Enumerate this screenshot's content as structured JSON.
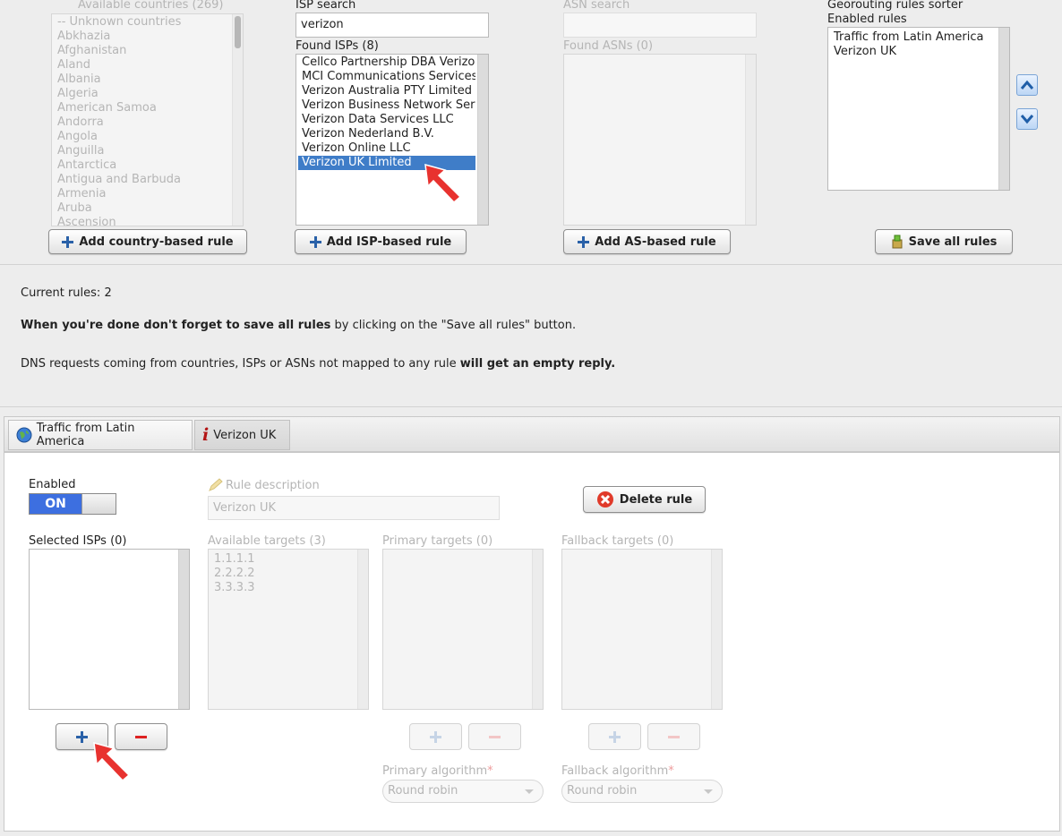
{
  "countries": {
    "label": "Available countries (269)",
    "items": [
      "-- Unknown countries",
      "Abkhazia",
      "Afghanistan",
      "Aland",
      "Albania",
      "Algeria",
      "American Samoa",
      "Andorra",
      "Angola",
      "Anguilla",
      "Antarctica",
      "Antigua and Barbuda",
      "Armenia",
      "Aruba",
      "Ascension"
    ],
    "add_button": "Add country-based rule"
  },
  "isp": {
    "search_label": "ISP search",
    "search_value": "verizon",
    "found_label": "Found ISPs (8)",
    "items": [
      "Cellco Partnership DBA Verizon",
      "MCI Communications Services,",
      "Verizon Australia PTY Limited",
      "Verizon Business Network Serv",
      "Verizon Data Services LLC",
      "Verizon Nederland B.V.",
      "Verizon Online LLC",
      "Verizon UK Limited"
    ],
    "selected": "Verizon UK Limited",
    "add_button": "Add ISP-based rule"
  },
  "asn": {
    "search_label": "ASN search",
    "search_value": "",
    "found_label": "Found ASNs (0)",
    "add_button": "Add AS-based rule"
  },
  "sorter": {
    "title": "Georouting rules sorter",
    "enabled_label": "Enabled rules",
    "items": [
      "Traffic from Latin America",
      "Verizon UK"
    ],
    "save_button": "Save all rules"
  },
  "info": {
    "current_rules": "Current rules: 2",
    "save_bold": "When you're done don't forget to save all rules",
    "save_rest": " by clicking on the \"Save all rules\" button.",
    "dns_text": "DNS requests coming from countries, ISPs or ASNs not mapped to any rule ",
    "dns_bold": "will get an empty reply."
  },
  "tabs": [
    {
      "label": "Traffic from Latin America",
      "icon": "globe-icon"
    },
    {
      "label": "Verizon UK",
      "icon": "info-icon"
    }
  ],
  "rule": {
    "enabled_label": "Enabled",
    "toggle_on": "ON",
    "description_label": "Rule description",
    "description_value": "Verizon UK",
    "delete_button": "Delete rule",
    "selected_isps_label": "Selected ISPs (0)",
    "available_targets_label": "Available targets (3)",
    "available_targets": [
      "1.1.1.1",
      "2.2.2.2",
      "3.3.3.3"
    ],
    "primary_targets_label": "Primary targets (0)",
    "fallback_targets_label": "Fallback targets (0)",
    "primary_algorithm_label": "Primary algorithm",
    "primary_algorithm_value": "Round robin",
    "fallback_algorithm_label": "Fallback algorithm",
    "fallback_algorithm_value": "Round robin",
    "required_mark": "*"
  },
  "colors": {
    "selection": "#3f7dc8",
    "toggle_on": "#3d6fe0",
    "annotation_arrow": "#e8322f"
  }
}
